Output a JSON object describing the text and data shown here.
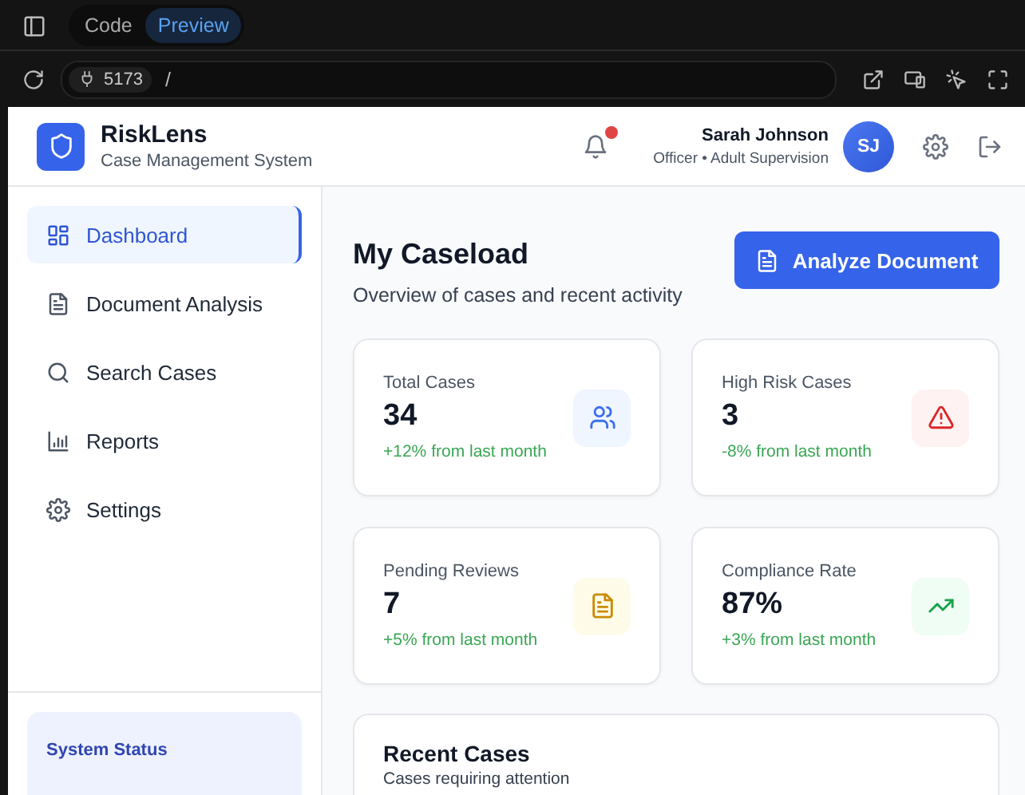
{
  "editor": {
    "tabs": [
      {
        "label": "Code",
        "selected": false
      },
      {
        "label": "Preview",
        "selected": true
      }
    ],
    "address": {
      "port": "5173",
      "path": "/"
    }
  },
  "header": {
    "app_name": "RiskLens",
    "tagline": "Case Management System",
    "has_notification": true,
    "user": {
      "name": "Sarah Johnson",
      "role": "Officer • Adult Supervision",
      "initials": "SJ"
    }
  },
  "sidebar": {
    "items": [
      {
        "label": "Dashboard",
        "kind": "grid",
        "selected": true
      },
      {
        "label": "Document Analysis",
        "kind": "doc",
        "selected": false
      },
      {
        "label": "Search Cases",
        "kind": "search",
        "selected": false
      },
      {
        "label": "Reports",
        "kind": "bars",
        "selected": false
      },
      {
        "label": "Settings",
        "kind": "gear",
        "selected": false
      }
    ],
    "status_title": "System Status"
  },
  "main": {
    "title": "My Caseload",
    "subtitle": "Overview of cases and recent activity",
    "action": "Analyze Document",
    "stats": [
      {
        "label": "Total Cases",
        "value": "34",
        "change": "+12% from last month",
        "kind": "users"
      },
      {
        "label": "High Risk Cases",
        "value": "3",
        "change": "-8% from last month",
        "kind": "alert"
      },
      {
        "label": "Pending Reviews",
        "value": "7",
        "change": "+5% from last month",
        "kind": "doc"
      },
      {
        "label": "Compliance Rate",
        "value": "87%",
        "change": "+3% from last month",
        "kind": "trend"
      }
    ],
    "recent": {
      "title": "Recent Cases",
      "subtitle": "Cases requiring attention"
    }
  }
}
